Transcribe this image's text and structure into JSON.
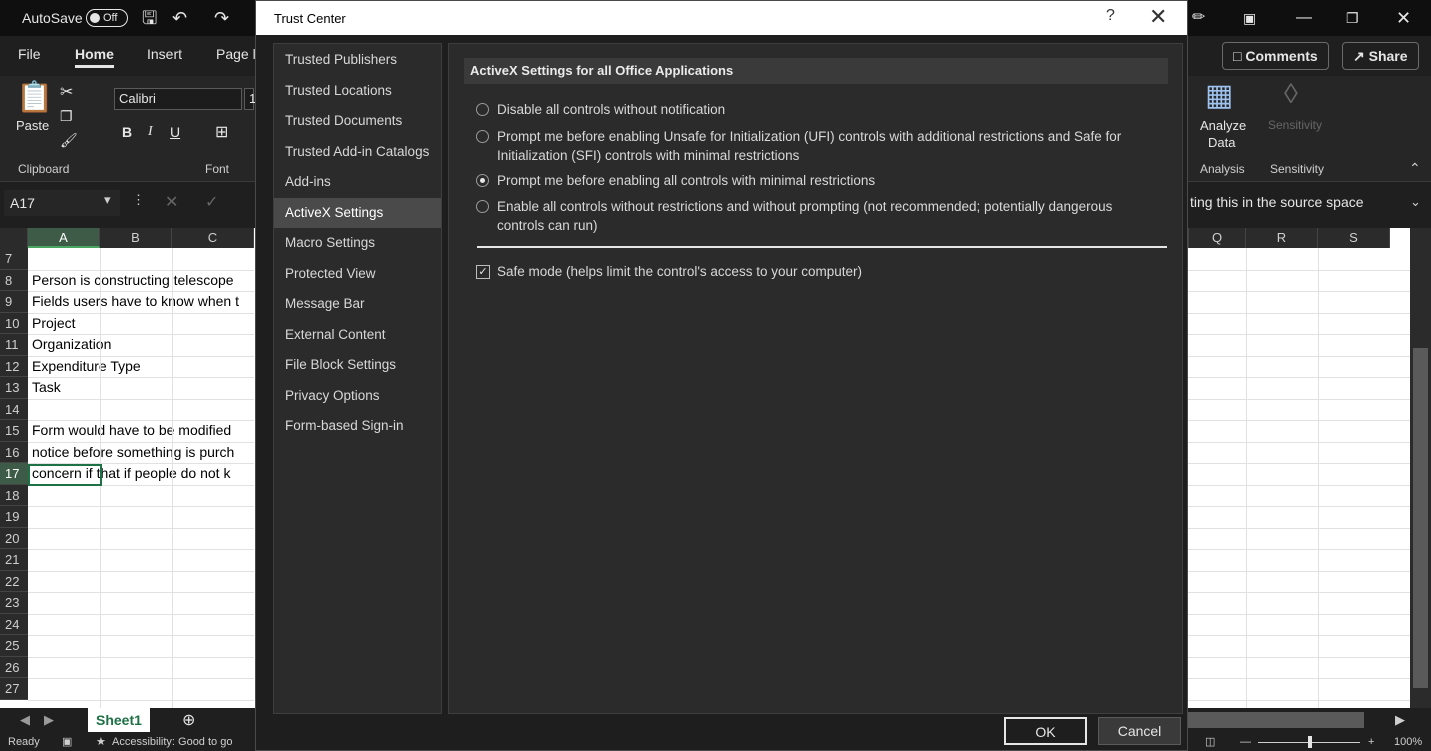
{
  "excel": {
    "autosave_label": "AutoSave",
    "autosave_state": "Off",
    "ribbon_tabs": [
      "File",
      "Home",
      "Insert",
      "Page l"
    ],
    "comments_label": "Comments",
    "share_label": "Share",
    "paste_label": "Paste",
    "font_name": "Calibri",
    "font_size": "1",
    "clipboard_group": "Clipboard",
    "font_group": "Font",
    "analyze_label_1": "Analyze",
    "analyze_label_2": "Data",
    "sensitivity_btn": "Sensitivity",
    "analysis_group": "Analysis",
    "sensitivity_group": "Sensitivity",
    "name_box": "A17",
    "formula_text": "ting this in the source space",
    "columns_left": [
      "A",
      "B",
      "C"
    ],
    "columns_right": [
      "Q",
      "R",
      "S"
    ],
    "rows": [
      {
        "num": "7",
        "text": ""
      },
      {
        "num": "8",
        "text": "Person is constructing telescope"
      },
      {
        "num": "9",
        "text": "Fields users have to know when t"
      },
      {
        "num": "10",
        "text": "Project"
      },
      {
        "num": "11",
        "text": "Organization"
      },
      {
        "num": "12",
        "text": "Expenditure Type"
      },
      {
        "num": "13",
        "text": "Task"
      },
      {
        "num": "14",
        "text": ""
      },
      {
        "num": "15",
        "text": "Form would have to be modified"
      },
      {
        "num": "16",
        "text": "notice before something is purch"
      },
      {
        "num": "17",
        "text": "concern if that if people do not k"
      },
      {
        "num": "18",
        "text": ""
      },
      {
        "num": "19",
        "text": ""
      },
      {
        "num": "20",
        "text": ""
      },
      {
        "num": "21",
        "text": ""
      },
      {
        "num": "22",
        "text": ""
      },
      {
        "num": "23",
        "text": ""
      },
      {
        "num": "24",
        "text": ""
      },
      {
        "num": "25",
        "text": ""
      },
      {
        "num": "26",
        "text": ""
      },
      {
        "num": "27",
        "text": ""
      }
    ],
    "sheet_tab": "Sheet1",
    "status_ready": "Ready",
    "status_accessibility": "Accessibility: Good to go",
    "zoom": "100%"
  },
  "dialog": {
    "title": "Trust Center",
    "help": "?",
    "nav": [
      "Trusted Publishers",
      "Trusted Locations",
      "Trusted Documents",
      "Trusted Add-in Catalogs",
      "Add-ins",
      "ActiveX Settings",
      "Macro Settings",
      "Protected View",
      "Message Bar",
      "External Content",
      "File Block Settings",
      "Privacy Options",
      "Form-based Sign-in"
    ],
    "active_nav": "ActiveX Settings",
    "section_title": "ActiveX Settings for all Office Applications",
    "options": [
      {
        "label": "Disable all controls without notification",
        "selected": false
      },
      {
        "label": "Prompt me before enabling Unsafe for Initialization (UFI) controls with additional restrictions and Safe for Initialization (SFI) controls with minimal restrictions",
        "selected": false
      },
      {
        "label": "Prompt me before enabling all controls with minimal restrictions",
        "selected": true
      },
      {
        "label": "Enable all controls without restrictions and without prompting (not recommended; potentially dangerous controls can run)",
        "selected": false
      }
    ],
    "safe_mode_label": "Safe mode (helps limit the control's access to your computer)",
    "safe_mode_checked": true,
    "ok_label": "OK",
    "cancel_label": "Cancel"
  },
  "colors": {
    "dialog_bg": "#1e1e1e",
    "panel_bg": "#2b2b2b",
    "active_nav": "#4a4a4a",
    "excel_green": "#1e7145"
  }
}
